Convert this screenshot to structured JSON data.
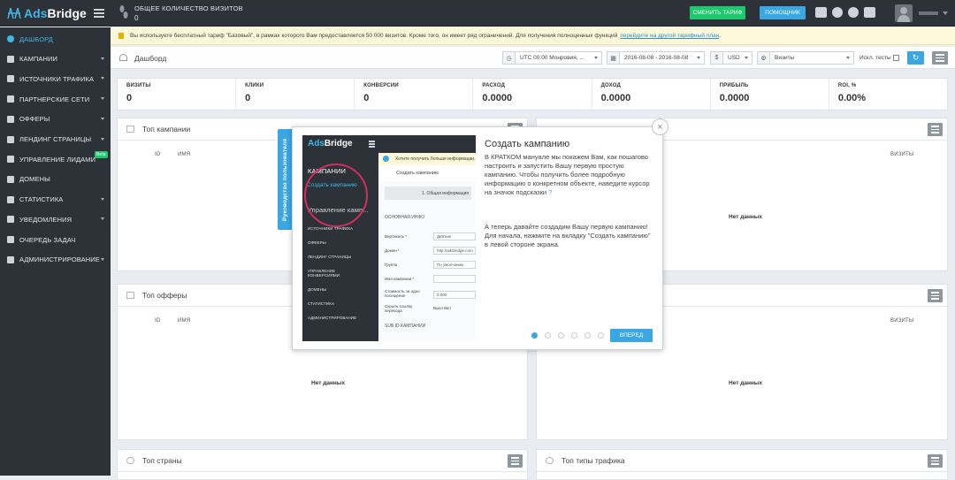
{
  "app": {
    "brand_prefix": "Ads",
    "brand_suffix": "Bridge"
  },
  "topbar": {
    "visits_label": "ОБЩЕЕ КОЛИЧЕСТВО ВИЗИТОВ",
    "visits_value": "0",
    "change_plan_label": "СМЕНИТЬ ТАРИФ",
    "helper_label": "ПОМОЩНИК",
    "icons": [
      "phone-icon",
      "info-icon",
      "help-icon",
      "id-card-icon"
    ],
    "accent": "#3aa7e3",
    "green": "#1ec86e"
  },
  "sidebar": {
    "items": [
      {
        "label": "ДАШБОРД",
        "icon": "dashboard-icon",
        "active": true
      },
      {
        "label": "КАМПАНИИ",
        "icon": "megaphone-icon",
        "caret": true
      },
      {
        "label": "ИСТОЧНИКИ ТРАФИКА",
        "icon": "share-icon",
        "caret": true
      },
      {
        "label": "ПАРТНЕРСКИЕ СЕТИ",
        "icon": "briefcase-icon",
        "caret": true
      },
      {
        "label": "ОФФЕРЫ",
        "icon": "tag-icon",
        "caret": true
      },
      {
        "label": "ЛЕНДИНГ СТРАНИЦЫ",
        "icon": "file-icon",
        "caret": true
      },
      {
        "label": "УПРАВЛЕНИЕ ЛИДАМИ",
        "icon": "database-icon",
        "badge": "Beta"
      },
      {
        "label": "ДОМЕНЫ",
        "icon": "link-icon"
      },
      {
        "label": "СТАТИСТИКА",
        "icon": "chart-icon",
        "caret": true
      },
      {
        "label": "УВЕДОМЛЕНИЯ",
        "icon": "bell-icon",
        "caret": true
      },
      {
        "label": "ОЧЕРЕДЬ ЗАДАЧ",
        "icon": "list-icon"
      },
      {
        "label": "АДМИНИСТРИРОВАНИЕ",
        "icon": "gear-icon",
        "caret": true
      }
    ]
  },
  "notice": {
    "text": "Вы используете бесплатный тариф \"Базовый\", в рамках которого Вам предоставляется 50 000 визитов. Кроме того, он имеет ряд ограничений. Для получения полноценных функций",
    "link": "перейдите на другой тарифный план",
    "end": "."
  },
  "toolbar": {
    "title": "Дашборд",
    "timezone": "UTC 00:00 Монровия, ...",
    "date_range": "2016-08-08 - 2016-08-08",
    "currency_symbol": "$",
    "currency": "USD",
    "metric": "Визиты",
    "exclude_tests_label": "Искл. тесты"
  },
  "stats": [
    {
      "label": "ВИЗИТЫ",
      "value": "0"
    },
    {
      "label": "КЛИКИ",
      "value": "0"
    },
    {
      "label": "КОНВЕРСИИ",
      "value": "0"
    },
    {
      "label": "РАСХОД",
      "value": "0.0000"
    },
    {
      "label": "ДОХОД",
      "value": "0.0000"
    },
    {
      "label": "ПРИБЫЛЬ",
      "value": "0.0000"
    },
    {
      "label": "ROI, %",
      "value": "0.00%"
    }
  ],
  "panels": {
    "top_campaigns": {
      "title": "Топ кампании",
      "col_id": "ID",
      "col_name": "ИМЯ",
      "col_visits": "ВИЗИТЫ",
      "empty": "Нет данных"
    },
    "top_offers": {
      "title": "Топ офферы",
      "col_id": "ID",
      "col_name": "ИМЯ",
      "col_visits": "ВИЗИТЫ",
      "empty": "Нет данных"
    },
    "top_countries": {
      "title": "Топ страны"
    },
    "top_traffic_types": {
      "title": "Топ типы трафика"
    }
  },
  "tour": {
    "tab_label": "Руководство пользователя",
    "title": "Создать кампанию",
    "text1": "В КРАТКОМ мануале мы покажем Вам, как пошагово настроить и запустить Вашу первую простую кампанию. Чтобы получить более подробную информацию о конкретном объекте, наведите курсор на значок подсказки",
    "text1_hint": "?",
    "text2": "А теперь давайте создадим Вашу первую кампанию! Для начала, нажмите на вкладку \"Создать кампанию\" в левой стороне экрана.",
    "next_label": "ВПЕРЕД",
    "step": 1,
    "steps": 6,
    "close_icon": "close-icon",
    "screenshot": {
      "logo_prefix": "Ads",
      "logo_suffix": "Bridge",
      "notice": "Хотите получить больше информации...",
      "bar_title": "Создать кампанию",
      "menu": [
        "КАМПАНИИ",
        "Создать кампанию",
        "Управление камп...",
        "ИСТОЧНИКИ ТРАФИКА",
        "ОФФЕРЫ",
        "ЛЕНДИНГ СТРАНИЦЫ",
        "УПРАВЛЕНИЕ КОНВЕРСИЯМИ",
        "ДОМЕНЫ",
        "СТАТИСТИКА",
        "АДМИНИСТРИРОВАНИЕ"
      ],
      "form_tab": "1. Общая информация",
      "section1": "ОСНОВНАЯ ИНФО",
      "rows": [
        {
          "label": "Вертикаль *",
          "value": "Дейтинг"
        },
        {
          "label": "Домен *",
          "value": "http://adsbridge.com"
        },
        {
          "label": "Группа",
          "value": "По умолчанию"
        },
        {
          "label": "Имя кампании *",
          "value": ""
        },
        {
          "label": "Стоимость за одно посещение",
          "value": "0.000"
        },
        {
          "label": "Скрыть ссылку перехода",
          "value": "Выкл   Вкл"
        }
      ],
      "section2": "SUB ID КАМПАНИИ"
    }
  }
}
